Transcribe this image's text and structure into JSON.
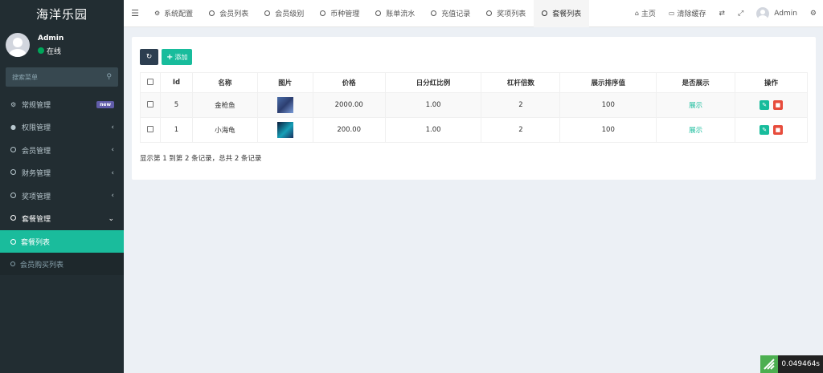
{
  "app": {
    "title": "海洋乐园"
  },
  "user": {
    "name": "Admin",
    "status": "在线"
  },
  "search": {
    "placeholder": "搜索菜单"
  },
  "menu": {
    "items": [
      {
        "label": "常规管理",
        "icon": "gears-icon",
        "badge": "new"
      },
      {
        "label": "权限管理",
        "icon": "users-icon"
      },
      {
        "label": "会员管理",
        "icon": "circle-icon"
      },
      {
        "label": "财务管理",
        "icon": "circle-icon"
      },
      {
        "label": "奖项管理",
        "icon": "circle-icon"
      },
      {
        "label": "套餐管理",
        "icon": "circle-icon"
      }
    ],
    "sub": [
      {
        "label": "套餐列表",
        "active": true
      },
      {
        "label": "会员购买列表",
        "active": false
      }
    ]
  },
  "topnav": {
    "tabs": [
      {
        "label": "系统配置",
        "icon": "gear-icon"
      },
      {
        "label": "会员列表",
        "icon": "circle-icon"
      },
      {
        "label": "会员级别",
        "icon": "circle-icon"
      },
      {
        "label": "币种管理",
        "icon": "circle-icon"
      },
      {
        "label": "账单流水",
        "icon": "circle-icon"
      },
      {
        "label": "充值记录",
        "icon": "circle-icon"
      },
      {
        "label": "奖项列表",
        "icon": "circle-icon"
      },
      {
        "label": "套餐列表",
        "icon": "circle-icon",
        "active": true
      }
    ],
    "home": "主页",
    "clear_cache": "清除缓存",
    "user": "Admin"
  },
  "toolbar": {
    "add_label": "添加"
  },
  "table": {
    "headers": [
      "Id",
      "名称",
      "图片",
      "价格",
      "日分红比例",
      "杠杆倍数",
      "展示排序值",
      "是否展示",
      "操作"
    ],
    "rows": [
      {
        "id": "5",
        "name": "金枪鱼",
        "price": "2000.00",
        "ratio": "1.00",
        "leverage": "2",
        "sort": "100",
        "show": "展示"
      },
      {
        "id": "1",
        "name": "小海龟",
        "price": "200.00",
        "ratio": "1.00",
        "leverage": "2",
        "sort": "100",
        "show": "展示"
      }
    ]
  },
  "pager": {
    "text": "显示第 1 到第 2 条记录，总共 2 条记录"
  },
  "perf": {
    "value": "0.049464s"
  },
  "colors": {
    "accent": "#18bc9c",
    "sidebar": "#222d32",
    "danger": "#e74c3c",
    "primary_dark": "#2c3e50"
  }
}
